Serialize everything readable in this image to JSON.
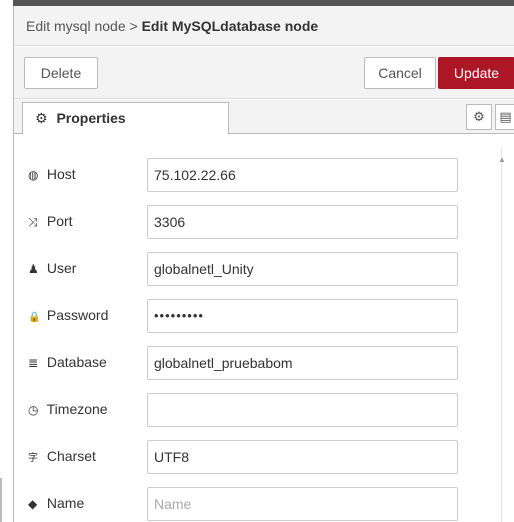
{
  "header": {
    "breadcrumb_parent": "Edit mysql node",
    "breadcrumb_separator": ">",
    "breadcrumb_current": "Edit MySQLdatabase node"
  },
  "toolbar": {
    "delete_label": "Delete",
    "cancel_label": "Cancel",
    "update_label": "Update"
  },
  "tabs": {
    "properties_label": "Properties"
  },
  "icons": {
    "gear": "⚙",
    "description": "▤",
    "host": "◍",
    "port": "⤨",
    "user": "♟",
    "password": "🔒",
    "database": "≣",
    "timezone": "◷",
    "charset": "字",
    "name": "◆"
  },
  "colors": {
    "primary": "#ad1625",
    "header_bg": "#f3f3f3"
  },
  "form": {
    "host": {
      "label": "Host",
      "value": "75.102.22.66"
    },
    "port": {
      "label": "Port",
      "value": "3306"
    },
    "user": {
      "label": "User",
      "value": "globalnetl_Unity"
    },
    "password": {
      "label": "Password",
      "value": "•••••••••"
    },
    "database": {
      "label": "Database",
      "value": "globalnetl_pruebabom"
    },
    "timezone": {
      "label": "Timezone",
      "value": ""
    },
    "charset": {
      "label": "Charset",
      "value": "UTF8"
    },
    "name": {
      "label": "Name",
      "value": "",
      "placeholder": "Name"
    }
  }
}
